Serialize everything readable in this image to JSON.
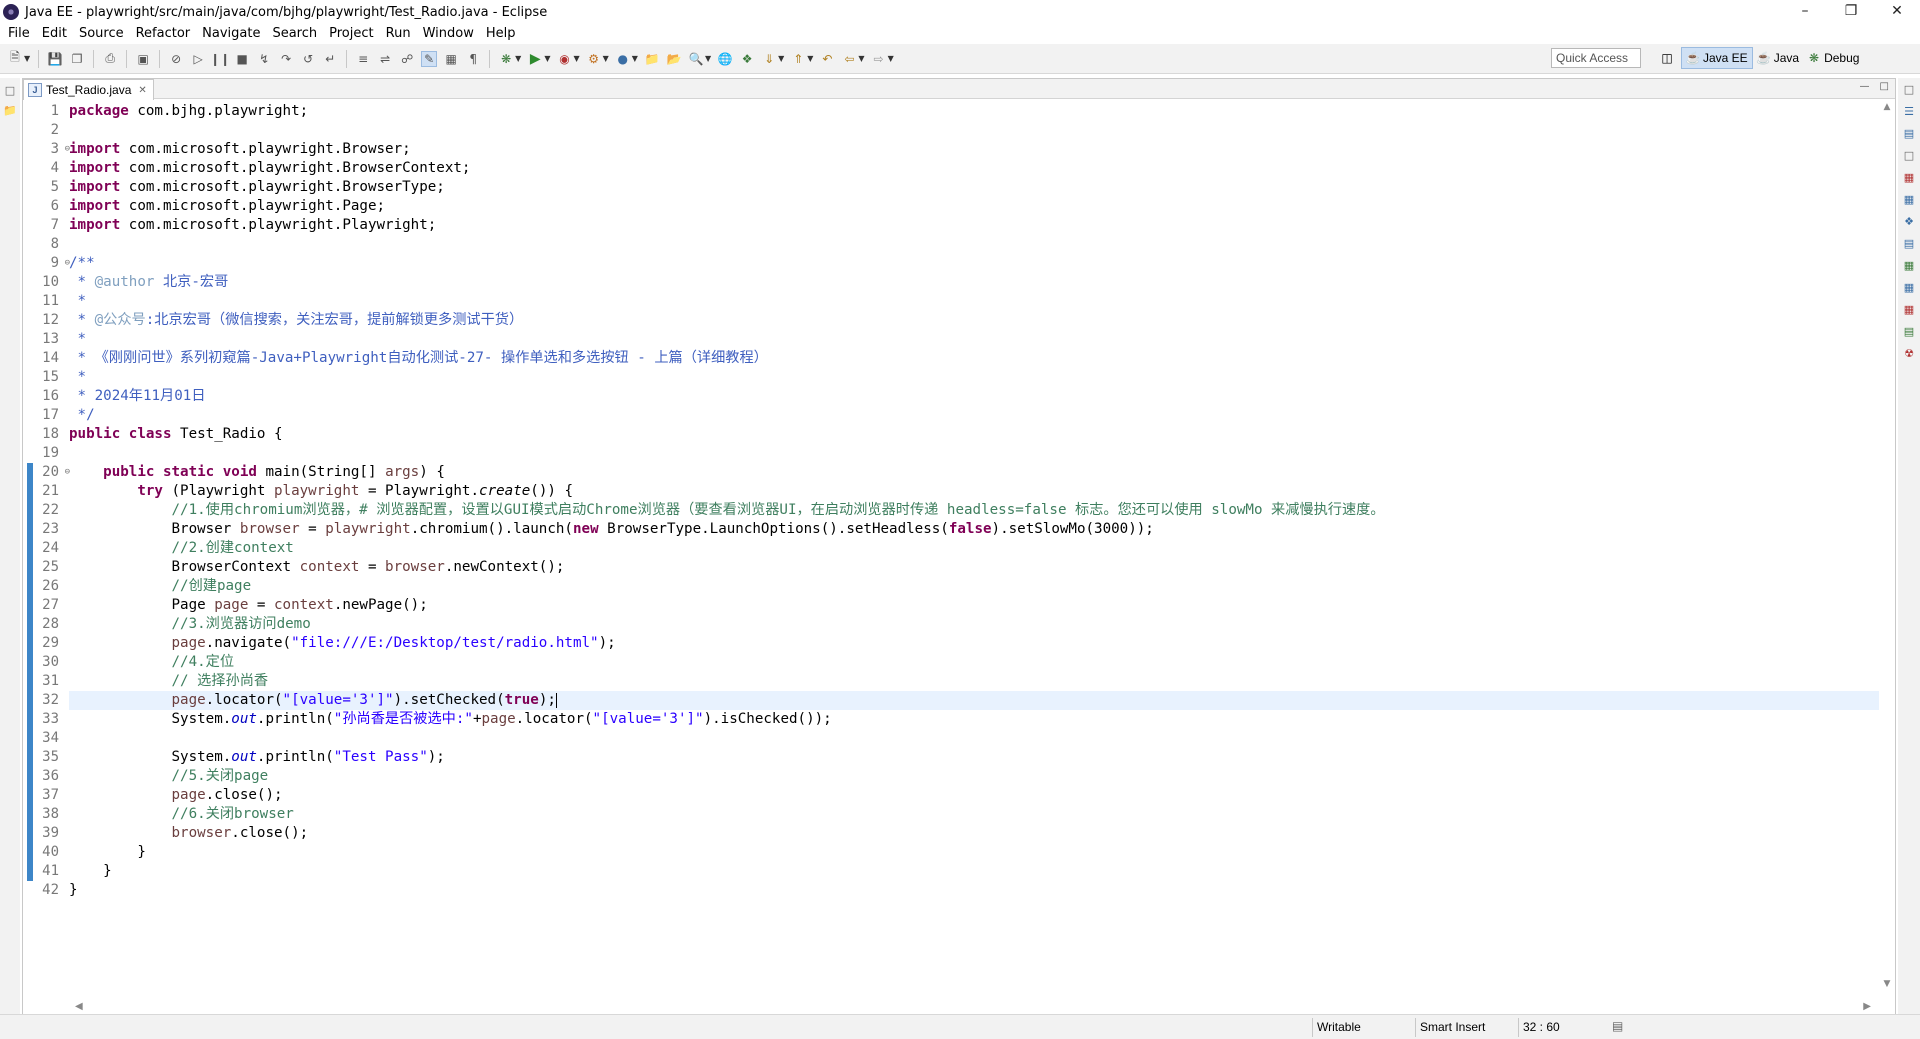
{
  "window": {
    "title": "Java EE - playwright/src/main/java/com/bjhg/playwright/Test_Radio.java - Eclipse"
  },
  "menu": [
    "File",
    "Edit",
    "Source",
    "Refactor",
    "Navigate",
    "Search",
    "Project",
    "Run",
    "Window",
    "Help"
  ],
  "toolbar": {
    "quick_access_placeholder": "Quick Access",
    "perspectives": [
      {
        "label": "Java EE",
        "icon": "java-ee-perspective-icon",
        "active": true
      },
      {
        "label": "Java",
        "icon": "java-perspective-icon",
        "active": false
      },
      {
        "label": "Debug",
        "icon": "debug-bug-icon",
        "active": false
      }
    ]
  },
  "editor": {
    "tab_label": "Test_Radio.java",
    "tab_icon": "java-file-icon",
    "current_line": 32,
    "changed_lines_from": 20,
    "changed_lines_to": 41,
    "lines": [
      "package com.bjhg.playwright;",
      "",
      "import com.microsoft.playwright.Browser;",
      "import com.microsoft.playwright.BrowserContext;",
      "import com.microsoft.playwright.BrowserType;",
      "import com.microsoft.playwright.Page;",
      "import com.microsoft.playwright.Playwright;",
      "",
      "/**",
      " * @author 北京-宏哥",
      " *",
      " * @公众号:北京宏哥（微信搜索，关注宏哥，提前解锁更多测试干货）",
      " *",
      " * 《刚刚问世》系列初窥篇-Java+Playwright自动化测试-27- 操作单选和多选按钮 - 上篇（详细教程）",
      " *",
      " * 2024年11月01日",
      " */",
      "public class Test_Radio {",
      "",
      "    public static void main(String[] args) {",
      "        try (Playwright playwright = Playwright.create()) {",
      "            //1.使用chromium浏览器，# 浏览器配置，设置以GUI模式启动Chrome浏览器（要查看浏览器UI，在启动浏览器时传递 headless=false 标志。您还可以使用 slowMo 来减慢执行速度。",
      "            Browser browser = playwright.chromium().launch(new BrowserType.LaunchOptions().setHeadless(false).setSlowMo(3000));",
      "            //2.创建context",
      "            BrowserContext context = browser.newContext();",
      "            //创建page",
      "            Page page = context.newPage();",
      "            //3.浏览器访问demo",
      "            page.navigate(\"file:///E:/Desktop/test/radio.html\");",
      "            //4.定位",
      "            // 选择孙尚香",
      "            page.locator(\"[value='3']\").setChecked(true);",
      "            System.out.println(\"孙尚香是否被选中:\"+page.locator(\"[value='3']\").isChecked());",
      "",
      "            System.out.println(\"Test Pass\");",
      "            //5.关闭page",
      "            page.close();",
      "            //6.关闭browser",
      "            browser.close();",
      "        }",
      "    }",
      "}"
    ]
  },
  "status": {
    "writable": "Writable",
    "insert_mode": "Smart Insert",
    "position": "32 : 60"
  },
  "colors": {
    "keyword": "#7f0055",
    "comment": "#3f7f5f",
    "javadoc": "#3f5fbf",
    "string": "#2a00ff",
    "field": "#0000c0",
    "local_variable": "#6a3e3e",
    "change_bar": "#3d86c8",
    "current_line": "#e8f2fe"
  }
}
